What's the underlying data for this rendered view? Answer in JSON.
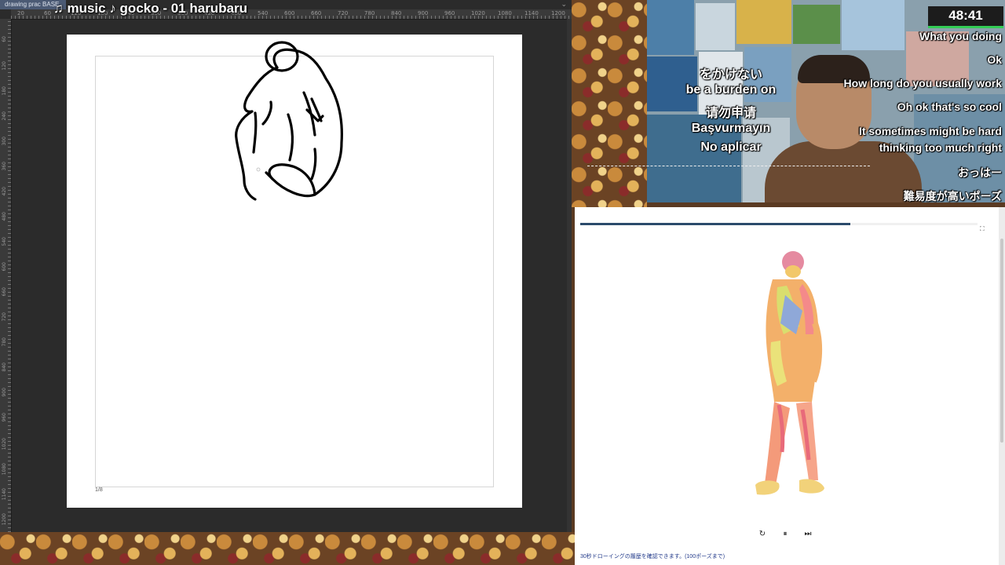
{
  "drawing_app": {
    "doc_tab": "drawing prac BASE",
    "ruler_top_ticks": [
      "20",
      "60",
      "120",
      "180",
      "240",
      "300",
      "360",
      "420",
      "480",
      "540",
      "600",
      "660",
      "720",
      "780",
      "840",
      "900",
      "960",
      "1020",
      "1080",
      "1140",
      "1200"
    ],
    "ruler_left_ticks": [
      "60",
      "120",
      "180",
      "240",
      "300",
      "360",
      "420",
      "480",
      "540",
      "600",
      "660",
      "720",
      "780",
      "840",
      "900",
      "960",
      "1020",
      "1080",
      "1140",
      "1200"
    ],
    "music_overlay": "♫ music ♪ gocko - 01 harubaru",
    "canvas_number": "1/8"
  },
  "stream": {
    "timer": "48:41",
    "chat_messages": [
      "What you doing",
      "Ok",
      "How long do you usually work",
      "Oh ok that's so cool",
      "It sometimes might be hard",
      "thinking too much right",
      "おっはー",
      "難易度が高いポーズ"
    ],
    "translation_caption": [
      "をかけない",
      "be a burden on",
      "请勿申请",
      "Başvurmayın",
      "No aplicar"
    ]
  },
  "pose_reference": {
    "progress_fraction": 0.68,
    "controls": {
      "restart": "↻",
      "pause": "⏸",
      "skip": "⏭"
    },
    "note": "30秒ドローイングの履歴を確認できます。(100ポーズまで)"
  },
  "colors": {
    "app_bg": "#2b2b2b",
    "progress": "#2b4a6b",
    "timer_bar": "#33cc55",
    "note_link": "#223a8a"
  }
}
